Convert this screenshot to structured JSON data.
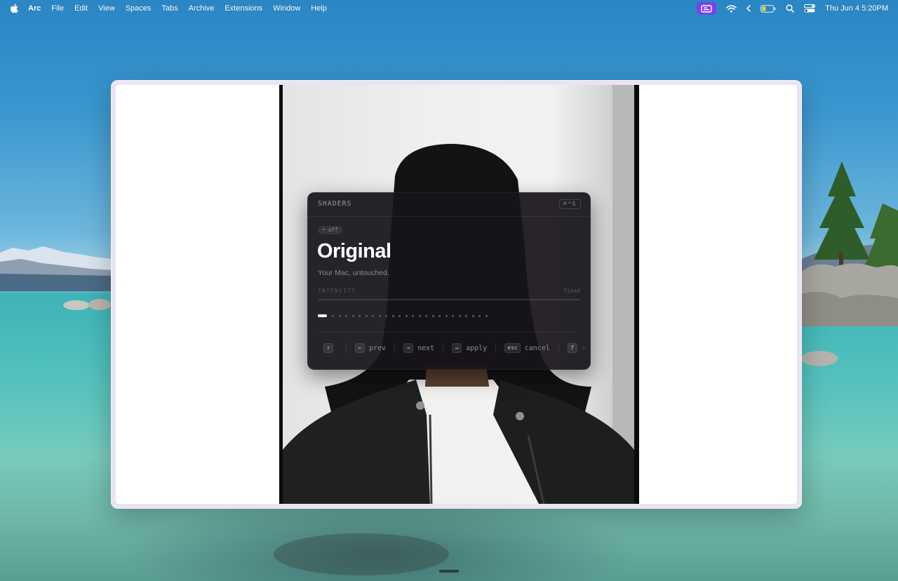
{
  "menubar": {
    "app_name": "Arc",
    "items": [
      "File",
      "Edit",
      "View",
      "Spaces",
      "Tabs",
      "Archive",
      "Extensions",
      "Window",
      "Help"
    ],
    "clock": "Thu Jun 4  5:20PM",
    "accent_color": "#7b3ff0"
  },
  "panel": {
    "title": "SHADERS",
    "shortcut": "⌘⌃S",
    "status": "• off",
    "shader_name": "Original",
    "shader_description": "Your Mac, untouched.",
    "intensity_label": "INTENSITY",
    "intensity_value": "fixed",
    "intensity_level": 0,
    "shader_count": 25,
    "active_index": 0,
    "hints": {
      "up_key": "↑",
      "prev_key": "←",
      "prev_label": "prev",
      "next_key": "→",
      "next_label": "next",
      "apply_key": "↵",
      "apply_label": "apply",
      "cancel_key": "esc",
      "cancel_label": "cancel",
      "fav_key": "f",
      "fav_label": "☆ fa"
    }
  }
}
